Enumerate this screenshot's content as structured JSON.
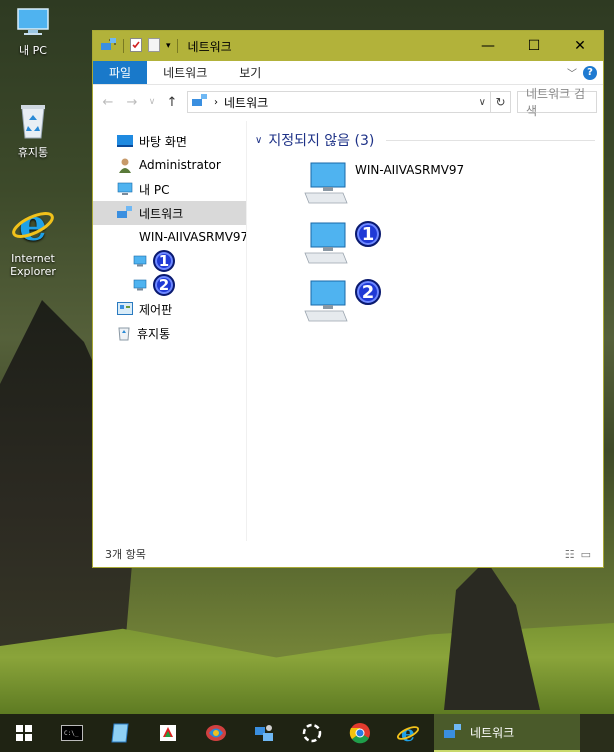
{
  "desktop": {
    "icons": [
      {
        "label": "내 PC"
      },
      {
        "label": "휴지통"
      },
      {
        "label": "Internet\nExplorer"
      }
    ]
  },
  "window": {
    "title": "네트워크",
    "ribbon": {
      "tabs": [
        "파일",
        "네트워크",
        "보기"
      ],
      "help_label": "?"
    },
    "address": {
      "crumb": "네트워크",
      "search_placeholder": "네트워크 검색"
    },
    "nav": {
      "items": [
        "바탕 화면",
        "Administrator",
        "내 PC",
        "네트워크",
        "WIN-AIIVASRMV97",
        "휴지통",
        "제어판"
      ]
    },
    "content": {
      "group_header": "지정되지 않음 (3)",
      "computers": [
        {
          "name": "WIN-AIIVASRMV97"
        }
      ]
    },
    "status": {
      "count": "3개 항목"
    }
  },
  "annotations": {
    "marker_1": "1",
    "marker_2": "2"
  },
  "taskbar": {
    "active_label": "네트워크"
  },
  "colors": {
    "titlebar": "#b2b23a",
    "file_tab": "#1979ca",
    "group_header": "#1e3287",
    "badge": "#1f3ad6"
  }
}
